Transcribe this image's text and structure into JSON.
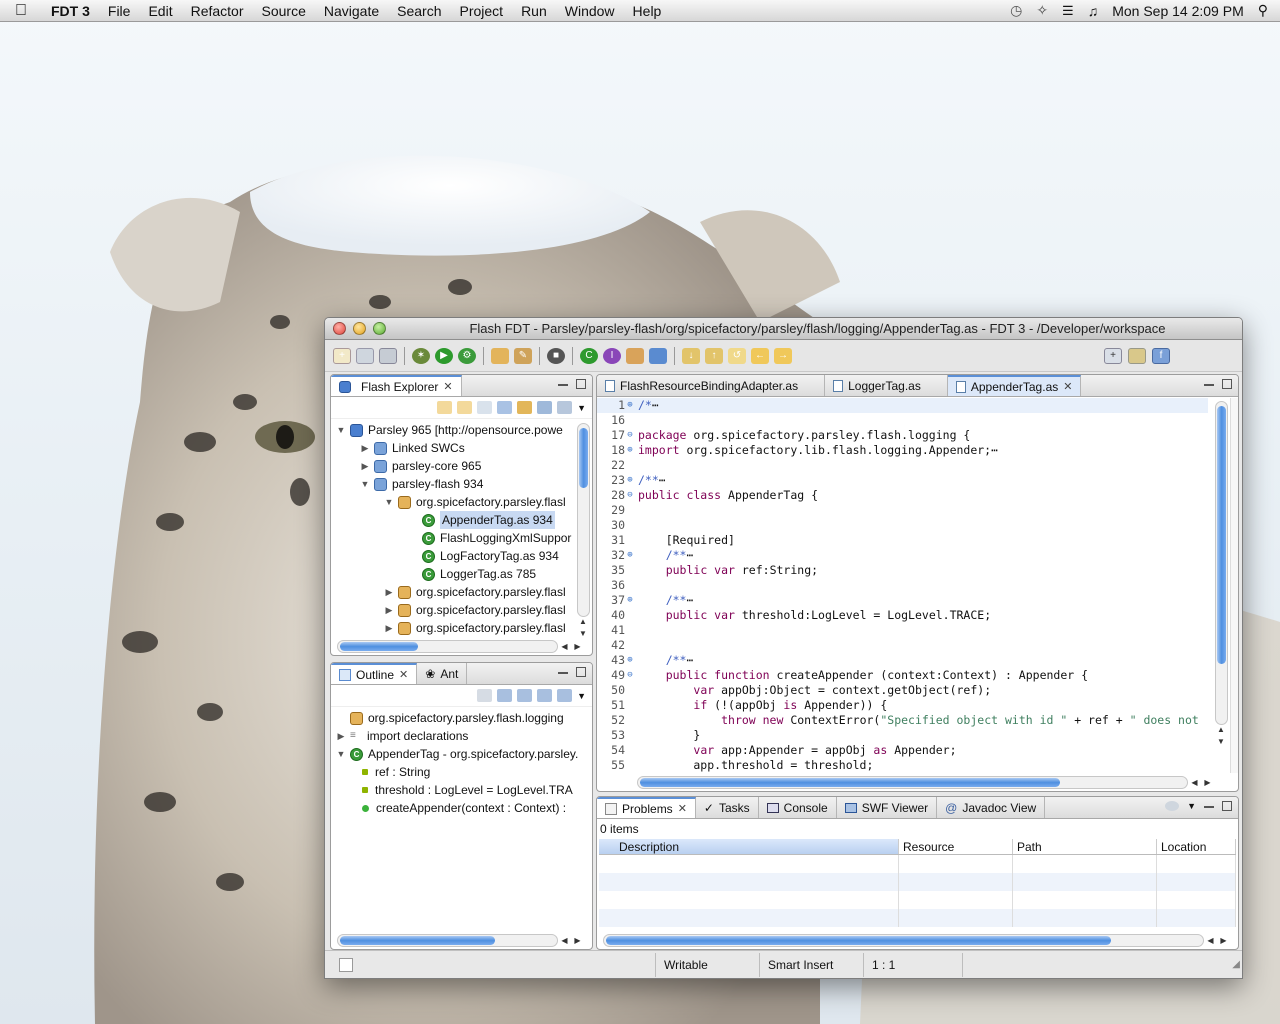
{
  "menubar": {
    "app_name": "FDT 3",
    "items": [
      "File",
      "Edit",
      "Refactor",
      "Source",
      "Navigate",
      "Search",
      "Project",
      "Run",
      "Window",
      "Help"
    ],
    "clock": "Mon Sep 14  2:09 PM"
  },
  "window": {
    "title": "Flash FDT - Parsley/parsley-flash/org/spicefactory/parsley/flash/logging/AppenderTag.as - FDT 3 - /Developer/workspace"
  },
  "explorer": {
    "tab_label": "Flash Explorer",
    "rows": [
      "Parsley 965 [http://opensource.powe",
      "Linked SWCs",
      "parsley-core 965",
      "parsley-flash 934",
      "org.spicefactory.parsley.flasl",
      "AppenderTag.as 934",
      "FlashLoggingXmlSuppor",
      "LogFactoryTag.as 934",
      "LoggerTag.as 785",
      "org.spicefactory.parsley.flasl",
      "org.spicefactory.parsley.flasl",
      "org.spicefactory.parsley.flasl"
    ]
  },
  "outline": {
    "tab_label": "Outline",
    "tab2_label": "Ant",
    "rows": [
      "org.spicefactory.parsley.flash.logging",
      "import declarations",
      "AppenderTag - org.spicefactory.parsley.",
      "ref : String",
      "threshold : LogLevel = LogLevel.TRA",
      "createAppender(context : Context) :"
    ]
  },
  "editor": {
    "tabs": [
      "FlashResourceBindingAdapter.as",
      "LoggerTag.as",
      "AppenderTag.as"
    ],
    "lines": [
      {
        "n": "1",
        "f": "⊕",
        "seg": [
          [
            "cm",
            "/*"
          ],
          [
            "",
            "⋯"
          ]
        ]
      },
      {
        "n": "16",
        "f": "",
        "seg": []
      },
      {
        "n": "17",
        "f": "⊖",
        "seg": [
          [
            "kw",
            "package"
          ],
          [
            "",
            " org.spicefactory.parsley.flash.logging {"
          ]
        ]
      },
      {
        "n": "18",
        "f": "⊕",
        "seg": [
          [
            "kw",
            "import"
          ],
          [
            "",
            " org.spicefactory.lib.flash.logging.Appender;⋯"
          ]
        ]
      },
      {
        "n": "22",
        "f": "",
        "seg": []
      },
      {
        "n": "23",
        "f": "⊕",
        "seg": [
          [
            "cm",
            "/**"
          ],
          [
            "",
            "⋯"
          ]
        ]
      },
      {
        "n": "28",
        "f": "⊖",
        "seg": [
          [
            "kw",
            "public class"
          ],
          [
            "",
            " AppenderTag {"
          ]
        ]
      },
      {
        "n": "29",
        "f": "",
        "seg": []
      },
      {
        "n": "30",
        "f": "",
        "seg": []
      },
      {
        "n": "31",
        "f": "",
        "seg": [
          [
            "",
            "    [Required]"
          ]
        ]
      },
      {
        "n": "32",
        "f": "⊕",
        "seg": [
          [
            "",
            "    "
          ],
          [
            "cm",
            "/**"
          ],
          [
            "",
            "⋯"
          ]
        ]
      },
      {
        "n": "35",
        "f": "",
        "seg": [
          [
            "",
            "    "
          ],
          [
            "kw",
            "public var"
          ],
          [
            "",
            " ref:String;"
          ]
        ]
      },
      {
        "n": "36",
        "f": "",
        "seg": []
      },
      {
        "n": "37",
        "f": "⊕",
        "seg": [
          [
            "",
            "    "
          ],
          [
            "cm",
            "/**"
          ],
          [
            "",
            "⋯"
          ]
        ]
      },
      {
        "n": "40",
        "f": "",
        "seg": [
          [
            "",
            "    "
          ],
          [
            "kw",
            "public var"
          ],
          [
            "",
            " threshold:LogLevel = LogLevel.TRACE;"
          ]
        ]
      },
      {
        "n": "41",
        "f": "",
        "seg": []
      },
      {
        "n": "42",
        "f": "",
        "seg": []
      },
      {
        "n": "43",
        "f": "⊕",
        "seg": [
          [
            "",
            "    "
          ],
          [
            "cm",
            "/**"
          ],
          [
            "",
            "⋯"
          ]
        ]
      },
      {
        "n": "49",
        "f": "⊖",
        "seg": [
          [
            "",
            "    "
          ],
          [
            "kw",
            "public function"
          ],
          [
            "",
            " createAppender (context:Context) : Appender {"
          ]
        ]
      },
      {
        "n": "50",
        "f": "",
        "seg": [
          [
            "",
            "        "
          ],
          [
            "kw",
            "var"
          ],
          [
            "",
            " appObj:Object = context.getObject(ref);"
          ]
        ]
      },
      {
        "n": "51",
        "f": "",
        "seg": [
          [
            "",
            "        "
          ],
          [
            "kw",
            "if"
          ],
          [
            "",
            " (!(appObj "
          ],
          [
            "kw",
            "is"
          ],
          [
            "",
            " Appender)) {"
          ]
        ]
      },
      {
        "n": "52",
        "f": "",
        "seg": [
          [
            "",
            "            "
          ],
          [
            "kw",
            "throw new"
          ],
          [
            "",
            " ContextError("
          ],
          [
            "ov",
            "\"Specified object with id \""
          ],
          [
            "",
            " + ref + "
          ],
          [
            "ov",
            "\" does not"
          ]
        ]
      },
      {
        "n": "53",
        "f": "",
        "seg": [
          [
            "",
            "        }"
          ]
        ]
      },
      {
        "n": "54",
        "f": "",
        "seg": [
          [
            "",
            "        "
          ],
          [
            "kw",
            "var"
          ],
          [
            "",
            " app:Appender = appObj "
          ],
          [
            "kw",
            "as"
          ],
          [
            "",
            " Appender;"
          ]
        ]
      },
      {
        "n": "55",
        "f": "",
        "seg": [
          [
            "",
            "        app.threshold = threshold;"
          ]
        ]
      }
    ]
  },
  "problems": {
    "tabs": [
      "Problems",
      "Tasks",
      "Console",
      "SWF Viewer",
      "Javadoc View"
    ],
    "count": "0 items",
    "columns": [
      "Description",
      "Resource",
      "Path",
      "Location"
    ]
  },
  "status": {
    "writable": "Writable",
    "insert_mode": "Smart Insert",
    "position": "1 : 1"
  },
  "colors": {
    "accent": "#5b8fd6",
    "keyword": "#7f0055",
    "comment": "#3f5fbf",
    "string": "#3f7f5f"
  }
}
